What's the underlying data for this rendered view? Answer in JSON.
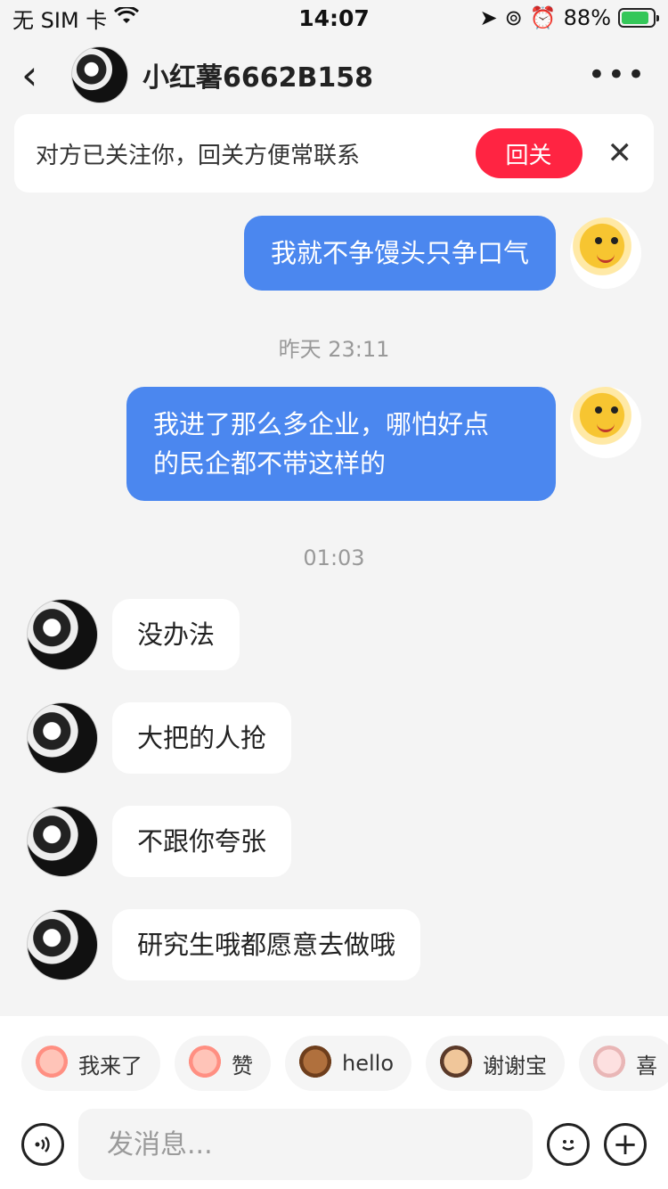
{
  "status_bar": {
    "carrier": "无 SIM 卡",
    "time": "14:07",
    "battery": "88%",
    "battery_level": 0.88
  },
  "header": {
    "title": "小红薯6662B158",
    "back_icon": "chevron-left-icon",
    "more_icon": "more-dots-icon"
  },
  "follow_banner": {
    "text": "对方已关注你，回关方便常联系",
    "button": "回关",
    "button_color": "#ff2442"
  },
  "messages": [
    {
      "side": "out",
      "text": "我就不争馒头只争口气"
    },
    {
      "timestamp": "昨天 23:11"
    },
    {
      "side": "out",
      "text": "我进了那么多企业，哪怕好点\n的民企都不带这样的"
    },
    {
      "timestamp": "01:03"
    },
    {
      "side": "in",
      "text": "没办法"
    },
    {
      "side": "in",
      "text": "大把的人抢"
    },
    {
      "side": "in",
      "text": "不跟你夸张"
    },
    {
      "side": "in",
      "text": "研究生哦都愿意去做哦"
    }
  ],
  "quick_replies": [
    "我来了",
    "赞",
    "hello",
    "谢谢宝",
    "喜"
  ],
  "input": {
    "placeholder": "发消息..."
  },
  "colors": {
    "outgoing_bubble": "#4b87ef",
    "incoming_bubble": "#ffffff",
    "background": "#f4f4f4"
  }
}
